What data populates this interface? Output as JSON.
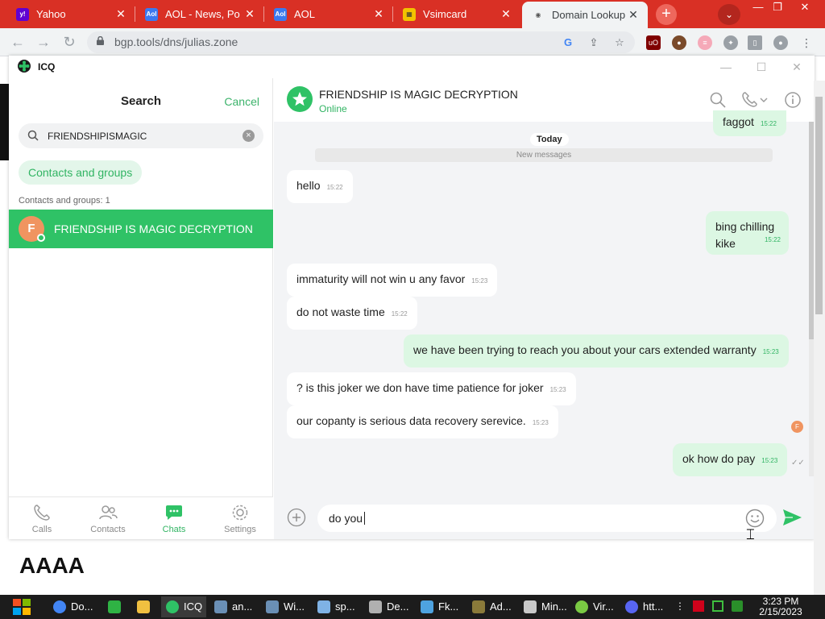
{
  "browser": {
    "tabs": [
      {
        "title": "Yahoo",
        "favicon": "yahoo-icon",
        "color": "#6001d2"
      },
      {
        "title": "AOL - News, Po",
        "favicon": "aol-icon",
        "color": "#3b79f0"
      },
      {
        "title": "AOL",
        "favicon": "aol-icon",
        "color": "#3b79f0"
      },
      {
        "title": "Vsimcard",
        "favicon": "vsimcard-icon",
        "color": "#f2c200"
      },
      {
        "title": "Domain Lookup -",
        "favicon": "domain-lookup-icon",
        "color": "#ffffff"
      }
    ],
    "url": "bgp.tools/dns/julias.zone"
  },
  "icq": {
    "app_title": "ICQ",
    "sidebar": {
      "search_title": "Search",
      "cancel_label": "Cancel",
      "search_value": "FRIENDSHIPISMAGIC",
      "filter_chip": "Contacts and groups",
      "results_count": "Contacts and groups: 1",
      "result": {
        "avatar_letter": "F",
        "name": "FRIENDSHIP IS MAGIC DECRYPTION"
      },
      "nav": [
        {
          "label": "Calls",
          "icon": "phone-icon"
        },
        {
          "label": "Contacts",
          "icon": "contacts-icon"
        },
        {
          "label": "Chats",
          "icon": "chat-icon"
        },
        {
          "label": "Settings",
          "icon": "gear-icon"
        }
      ]
    },
    "chat": {
      "title": "FRIENDSHIP IS MAGIC DECRYPTION",
      "status": "Online",
      "day_label": "Today",
      "new_messages_label": "New messages",
      "partner_avatar_letter": "F",
      "messages": [
        {
          "direction": "out",
          "text": "faggot",
          "time": "15:22"
        },
        {
          "direction": "in",
          "text": "hello",
          "time": "15:22"
        },
        {
          "direction": "out",
          "text": "bing chilling kike",
          "time": "15:22"
        },
        {
          "direction": "in",
          "text": "immaturity will not win u any favor",
          "time": "15:23"
        },
        {
          "direction": "in",
          "text": "do not waste time",
          "time": "15:22"
        },
        {
          "direction": "out",
          "text": "we have been trying to reach you about your cars extended warranty",
          "time": "15:23"
        },
        {
          "direction": "in",
          "text": "? is this joker we don have time patience for joker",
          "time": "15:23"
        },
        {
          "direction": "in",
          "text": "our copanty is serious data recovery serevice.",
          "time": "15:23"
        },
        {
          "direction": "out",
          "text": "ok how do pay",
          "time": "15:23"
        }
      ],
      "composer_text": "do you"
    }
  },
  "background_text": "AAAA",
  "taskbar": {
    "items": [
      {
        "label": "Do...",
        "icon": "chrome-icon",
        "color": "#4285f4"
      },
      {
        "label": "",
        "icon": "notes-icon",
        "color": "#2fb344"
      },
      {
        "label": "",
        "icon": "folder-icon",
        "color": "#f0c040"
      },
      {
        "label": "ICQ",
        "icon": "icq-icon",
        "color": "#2fc266"
      },
      {
        "label": "an...",
        "icon": "app-icon",
        "color": "#6a8fb5"
      },
      {
        "label": "Wi...",
        "icon": "network-icon",
        "color": "#6a8fb5"
      },
      {
        "label": "sp...",
        "icon": "app-icon",
        "color": "#7fb2e5"
      },
      {
        "label": "De...",
        "icon": "app-icon",
        "color": "#b0b0b0"
      },
      {
        "label": "Fk...",
        "icon": "app-icon",
        "color": "#4ea3e0"
      },
      {
        "label": "Ad...",
        "icon": "app-icon",
        "color": "#8a7a3a"
      },
      {
        "label": "Min...",
        "icon": "notepad-icon",
        "color": "#c9c9c9"
      },
      {
        "label": "Vir...",
        "icon": "app-icon",
        "color": "#7ac943"
      },
      {
        "label": "htt...",
        "icon": "discord-icon",
        "color": "#5865f2"
      }
    ],
    "time": "3:23 PM",
    "date": "2/15/2023"
  }
}
